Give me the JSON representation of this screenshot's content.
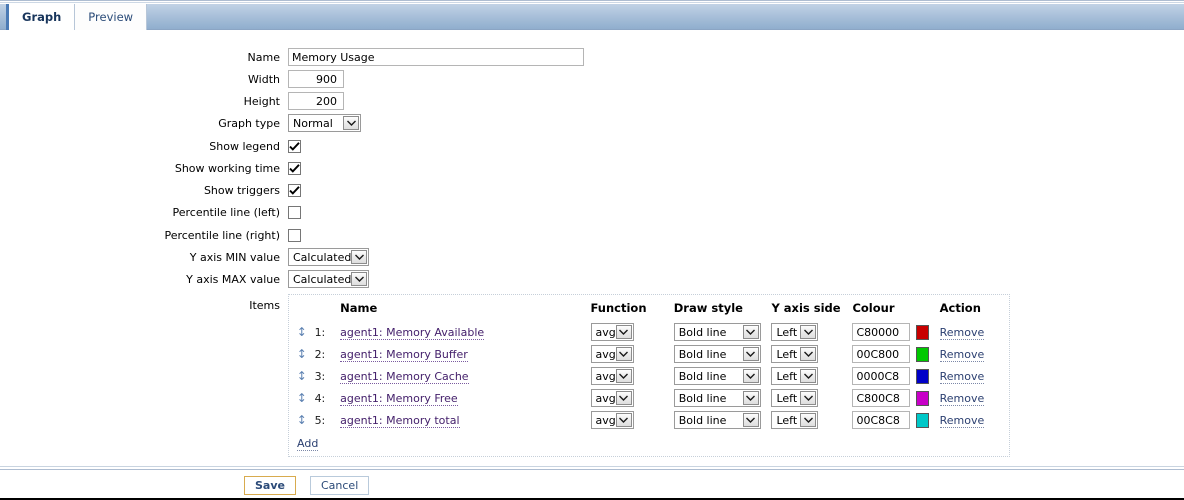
{
  "tabs": [
    {
      "label": "Graph",
      "active": true
    },
    {
      "label": "Preview",
      "active": false
    }
  ],
  "form": {
    "name": {
      "label": "Name",
      "value": "Memory Usage"
    },
    "width": {
      "label": "Width",
      "value": "900"
    },
    "height": {
      "label": "Height",
      "value": "200"
    },
    "graph_type": {
      "label": "Graph type",
      "value": "Normal"
    },
    "show_legend": {
      "label": "Show legend",
      "checked": true
    },
    "show_working_time": {
      "label": "Show working time",
      "checked": true
    },
    "show_triggers": {
      "label": "Show triggers",
      "checked": true
    },
    "percentile_left": {
      "label": "Percentile line (left)",
      "checked": false
    },
    "percentile_right": {
      "label": "Percentile line (right)",
      "checked": false
    },
    "y_axis_min": {
      "label": "Y axis MIN value",
      "value": "Calculated"
    },
    "y_axis_max": {
      "label": "Y axis MAX value",
      "value": "Calculated"
    },
    "items_label": "Items"
  },
  "items_table": {
    "headers": {
      "handle": "",
      "num": "",
      "name": "Name",
      "function": "Function",
      "draw_style": "Draw style",
      "y_axis_side": "Y axis side",
      "colour": "Colour",
      "action": "Action"
    },
    "add_label": "Add",
    "rows": [
      {
        "num": "1:",
        "name": "agent1: Memory Available",
        "function": "avg",
        "draw_style": "Bold line",
        "y_axis_side": "Left",
        "colour": "C80000",
        "swatch": "#C80000",
        "action": "Remove"
      },
      {
        "num": "2:",
        "name": "agent1: Memory Buffer",
        "function": "avg",
        "draw_style": "Bold line",
        "y_axis_side": "Left",
        "colour": "00C800",
        "swatch": "#00C800",
        "action": "Remove"
      },
      {
        "num": "3:",
        "name": "agent1: Memory Cache",
        "function": "avg",
        "draw_style": "Bold line",
        "y_axis_side": "Left",
        "colour": "0000C8",
        "swatch": "#0000C8",
        "action": "Remove"
      },
      {
        "num": "4:",
        "name": "agent1: Memory Free",
        "function": "avg",
        "draw_style": "Bold line",
        "y_axis_side": "Left",
        "colour": "C800C8",
        "swatch": "#C800C8",
        "action": "Remove"
      },
      {
        "num": "5:",
        "name": "agent1: Memory total",
        "function": "avg",
        "draw_style": "Bold line",
        "y_axis_side": "Left",
        "colour": "00C8C8",
        "swatch": "#00C8C8",
        "action": "Remove"
      }
    ]
  },
  "footer": {
    "save": "Save",
    "cancel": "Cancel"
  },
  "icons": {
    "drag_handle": "↕",
    "chevron_down": "chevron-down-icon",
    "checkmark": "check-icon"
  },
  "colors": {
    "tab_active_border": "#4a7ab5",
    "save_border": "#d8ab4e",
    "cancel_border": "#b9cadb",
    "link": "#44206b",
    "remove_link": "#2b3f70"
  }
}
